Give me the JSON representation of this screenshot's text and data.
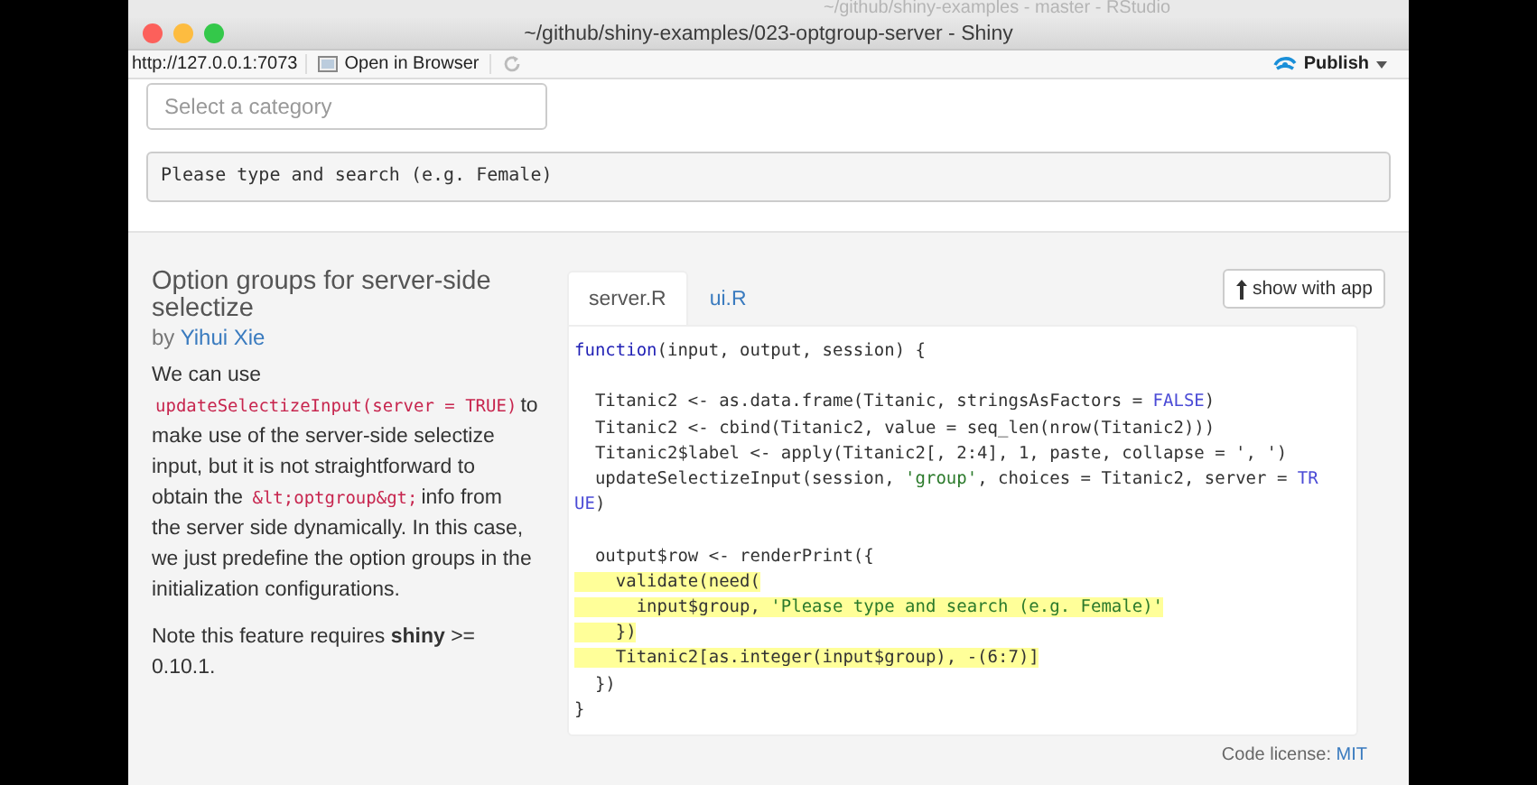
{
  "back_window": {
    "title": "~/github/shiny-examples - master - RStudio"
  },
  "window": {
    "title": "~/github/shiny-examples/023-optgroup-server - Shiny"
  },
  "toolbar": {
    "url": "http://127.0.0.1:7073",
    "open_in_browser": "Open in Browser",
    "publish": "Publish"
  },
  "app": {
    "category_select": {
      "placeholder": "Select a category"
    },
    "output_text": "Please type and search (e.g. Female)"
  },
  "sidebar": {
    "title": "Option groups for server-side selectize",
    "byline": "by",
    "author": "Yihui Xie",
    "paragraphs": [
      [
        {
          "kind": "text",
          "text": "We can use"
        },
        {
          "kind": "code",
          "text": "updateSelectizeInput(server = TRUE)"
        },
        {
          "kind": "text",
          "text": "to make use of the server-side selectize input, but it is not straightforward to obtain the"
        },
        {
          "kind": "code",
          "text": "&lt;optgroup&gt;"
        },
        {
          "kind": "text",
          "text": "info from the server side dynamically. In this case, we just predefine the option groups in the initialization configurations."
        }
      ],
      [
        {
          "kind": "text",
          "text": "Note this feature requires **shiny** >= 0.10.1."
        }
      ]
    ]
  },
  "code_panel": {
    "tabs": [
      {
        "label": "server.R",
        "selected": true
      },
      {
        "label": "ui.R",
        "selected": false
      }
    ],
    "show_with_app": "show with app",
    "lines": [
      {
        "highlighted": false,
        "segments": [
          {
            "kind": "keyword",
            "text": "function"
          },
          {
            "kind": "plain",
            "text": "(input, output, session) {"
          }
        ]
      },
      {
        "highlighted": false
      },
      {
        "highlighted": false,
        "segments": [
          {
            "kind": "plain",
            "text": "  Titanic2 <- as.data.frame(Titanic, stringsAsFactors = "
          },
          {
            "kind": "constant",
            "text": "FALSE"
          },
          {
            "kind": "plain",
            "text": ")"
          }
        ]
      },
      {
        "highlighted": false,
        "segments": [
          {
            "kind": "plain",
            "text": "  Titanic2 <- cbind(Titanic2, value = seq_len(nrow(Titanic2)))"
          }
        ]
      },
      {
        "highlighted": false,
        "segments": [
          {
            "kind": "plain",
            "text": "  Titanic2$label <- apply(Titanic2[, 2:4], 1, paste, collapse = ', ')"
          }
        ]
      },
      {
        "highlighted": false,
        "segments": [
          {
            "kind": "plain",
            "text": "  updateSelectizeInput(session, "
          },
          {
            "kind": "string",
            "text": "'group'"
          },
          {
            "kind": "plain",
            "text": ", choices = Titanic2, server = "
          },
          {
            "kind": "constant",
            "text": "TR"
          }
        ]
      },
      {
        "highlighted": false,
        "segments": [
          {
            "kind": "constant",
            "text": "UE"
          },
          {
            "kind": "plain",
            "text": ")"
          }
        ]
      },
      {
        "highlighted": false
      },
      {
        "highlighted": false,
        "segments": [
          {
            "kind": "plain",
            "text": "  output$row <- renderPrint({"
          }
        ]
      },
      {
        "highlighted": true,
        "segments": [
          {
            "kind": "plain",
            "text": "    validate(need("
          }
        ]
      },
      {
        "highlighted": true,
        "segments": [
          {
            "kind": "plain",
            "text": "      input$group, "
          },
          {
            "kind": "string",
            "text": "'Please type and search (e.g. Female)'"
          }
        ]
      },
      {
        "highlighted": true,
        "segments": [
          {
            "kind": "plain",
            "text": "    })"
          }
        ]
      },
      {
        "highlighted": true,
        "segments": [
          {
            "kind": "plain",
            "text": "    Titanic2[as.integer(input$group), -(6:7)]"
          }
        ]
      },
      {
        "highlighted": false,
        "segments": [
          {
            "kind": "plain",
            "text": "  })"
          }
        ]
      },
      {
        "highlighted": false,
        "segments": [
          {
            "kind": "plain",
            "text": "}"
          }
        ]
      }
    ]
  },
  "license": {
    "label": "Code license:",
    "link": "MIT"
  }
}
